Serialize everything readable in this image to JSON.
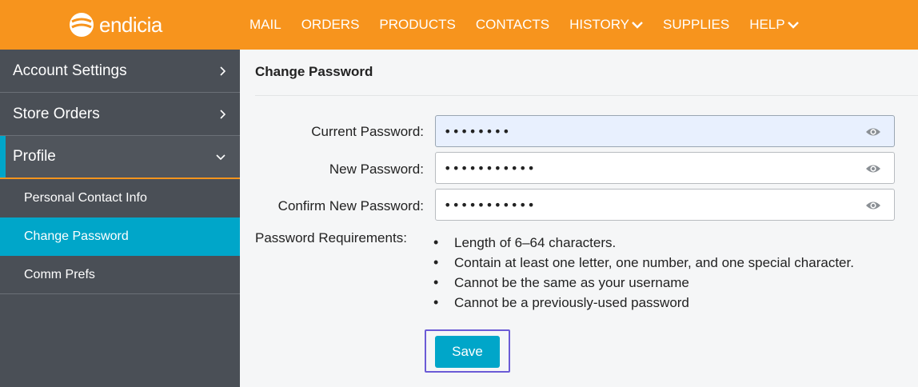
{
  "header": {
    "logo_text": "endicia",
    "nav": [
      {
        "label": "MAIL",
        "has_dropdown": false
      },
      {
        "label": "ORDERS",
        "has_dropdown": false
      },
      {
        "label": "PRODUCTS",
        "has_dropdown": false
      },
      {
        "label": "CONTACTS",
        "has_dropdown": false
      },
      {
        "label": "HISTORY",
        "has_dropdown": true
      },
      {
        "label": "SUPPLIES",
        "has_dropdown": false
      },
      {
        "label": "HELP",
        "has_dropdown": true
      }
    ]
  },
  "sidebar": {
    "sections": [
      {
        "label": "Account Settings",
        "chevron": "chevron-right-icon"
      },
      {
        "label": "Store Orders",
        "chevron": "chevron-right-icon"
      },
      {
        "label": "Profile",
        "chevron": "chevron-down-icon",
        "expanded": true
      }
    ],
    "sub_items": [
      {
        "label": "Personal Contact Info",
        "selected": false
      },
      {
        "label": "Change Password",
        "selected": true
      },
      {
        "label": "Comm Prefs",
        "selected": false
      }
    ]
  },
  "main": {
    "title": "Change Password",
    "fields": [
      {
        "label": "Current Password:",
        "value": "••••••••",
        "icon": "eye-icon"
      },
      {
        "label": "New Password:",
        "value": "•••••••••••",
        "icon": "eye-icon"
      },
      {
        "label": "Confirm New Password:",
        "value": "•••••••••••",
        "icon": "eye-icon"
      }
    ],
    "requirements_label": "Password Requirements:",
    "requirements": [
      "Length of 6–64 characters.",
      "Contain at least one letter, one number, and one special character.",
      "Cannot be the same as your username",
      "Cannot be a previously-used password"
    ],
    "save_label": "Save"
  },
  "colors": {
    "header_bg": "#f7941d",
    "sidebar_bg": "#4a4f56",
    "accent": "#00a6c9",
    "focus_outline": "#6b5bd6"
  }
}
